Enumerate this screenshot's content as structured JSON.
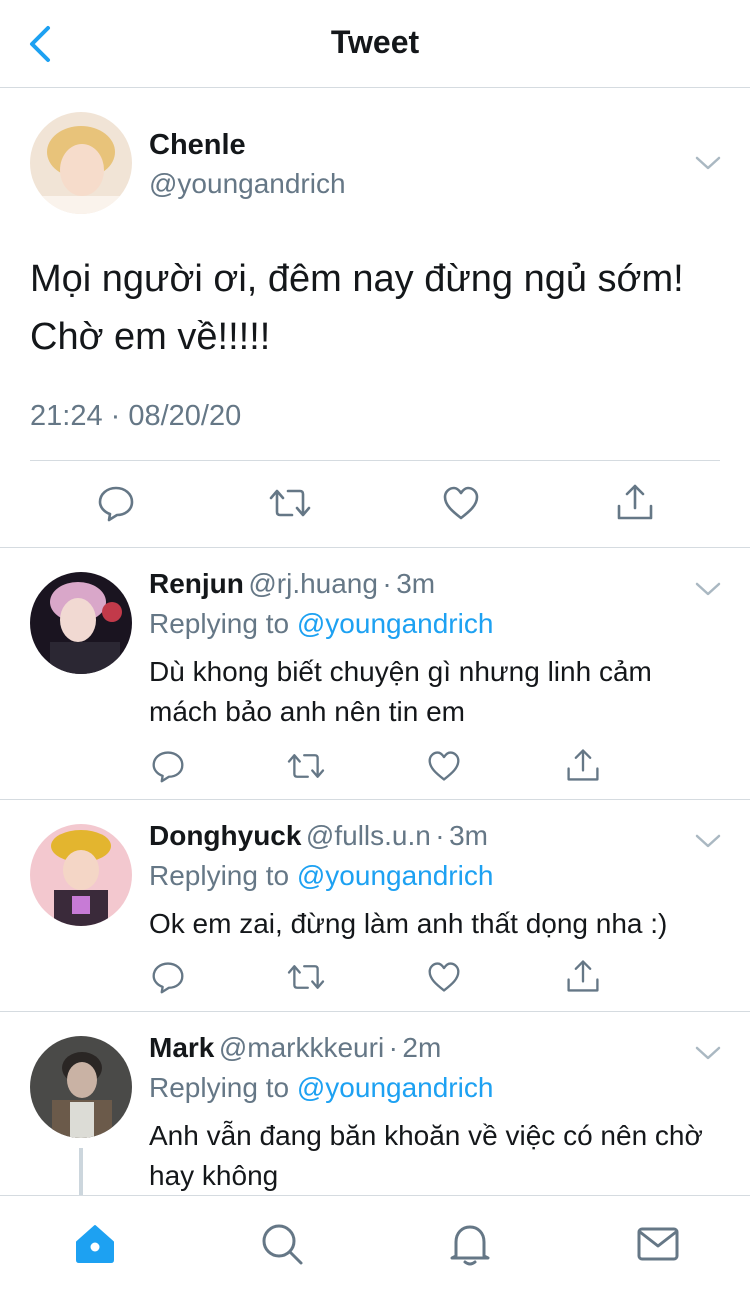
{
  "header": {
    "title": "Tweet"
  },
  "main_tweet": {
    "name": "Chenle",
    "handle": "@youngandrich",
    "text": "Mọi người ơi, đêm nay đừng ngủ sớm! Chờ em về!!!!!",
    "timestamp": "21:24 · 08/20/20"
  },
  "replies": [
    {
      "name": "Renjun",
      "handle": "@rj.huang",
      "time": "3m",
      "replying_prefix": "Replying to",
      "replying_to": "@youngandrich",
      "text": "Dù khong biết chuyện gì nhưng linh cảm mách bảo anh nên tin em"
    },
    {
      "name": "Donghyuck",
      "handle": "@fulls.u.n",
      "time": "3m",
      "replying_prefix": "Replying to",
      "replying_to": "@youngandrich",
      "text": "Ok em zai, đừng làm anh thất dọng nha :)"
    },
    {
      "name": "Mark",
      "handle": "@markkkeuri",
      "time": "2m",
      "replying_prefix": "Replying to",
      "replying_to": "@youngandrich",
      "text": "Anh vẫn đang băn khoăn về việc có nên chờ hay không"
    }
  ],
  "separator": "·",
  "tabbar": {
    "items": [
      "home-icon",
      "search-icon",
      "bell-icon",
      "mail-icon"
    ],
    "active": "home-icon"
  },
  "colors": {
    "accent": "#1da1f2",
    "secondary_text": "#657786",
    "border": "#d5dbe0"
  }
}
